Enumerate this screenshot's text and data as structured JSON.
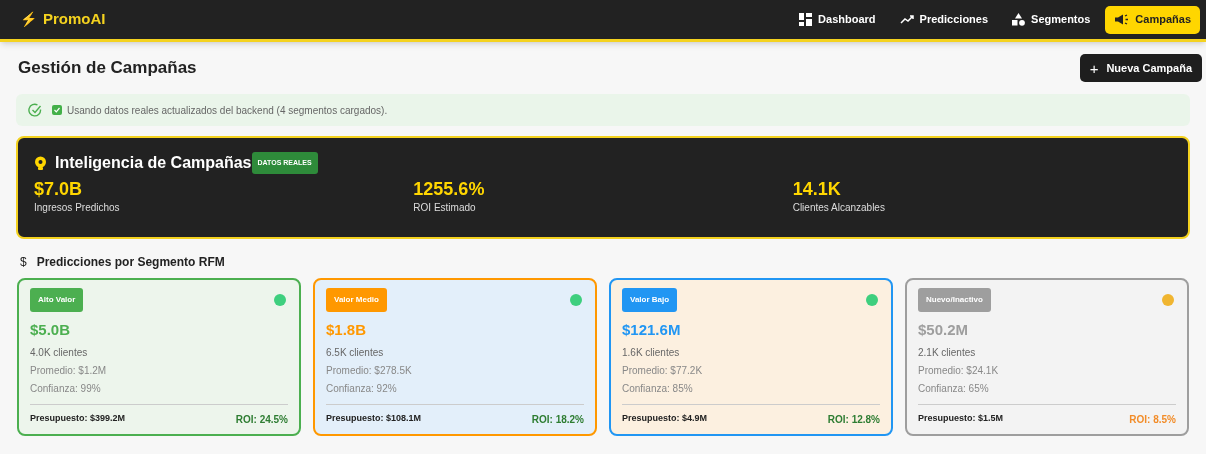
{
  "brand": {
    "icon": "⚡",
    "name": "PromoAI"
  },
  "nav": [
    {
      "label": "Dashboard",
      "kind": "grid",
      "selected": false
    },
    {
      "label": "Predicciones",
      "kind": "trend",
      "selected": false
    },
    {
      "label": "Segmentos",
      "kind": "shapes",
      "selected": false
    },
    {
      "label": "Campañas",
      "kind": "megaphone",
      "selected": true
    }
  ],
  "page_title": "Gestión de Campañas",
  "new_button": {
    "icon": "+",
    "label": "Nueva Campaña"
  },
  "alert": {
    "message": "Usando datos reales actualizados del backend (4 segmentos cargados).",
    "checked": true
  },
  "intelligence": {
    "title": "Inteligencia de Campañas",
    "badge": "DATOS REALES",
    "metrics": [
      {
        "value": "$7.0B",
        "label": "Ingresos Predichos"
      },
      {
        "value": "1255.6%",
        "label": "ROI Estimado"
      },
      {
        "value": "14.1K",
        "label": "Clientes Alcanzables"
      }
    ]
  },
  "section": {
    "icon": "$",
    "title": "Predicciones por Segmento RFM"
  },
  "segments": [
    {
      "name": "Alto Valor",
      "color": "#4caf50",
      "kind": "high",
      "warning": false,
      "revenue": "$5.0B",
      "clients": "4.0K clientes",
      "average": "Promedio: $1.2M",
      "confidence": "Confianza: 99%",
      "budget": "Presupuesto: $399.2M",
      "roi": "ROI: 24.5%",
      "roi_low": false
    },
    {
      "name": "Valor Medio",
      "color": "#ff9800",
      "kind": "medium",
      "warning": false,
      "revenue": "$1.8B",
      "clients": "6.5K clientes",
      "average": "Promedio: $278.5K",
      "confidence": "Confianza: 92%",
      "budget": "Presupuesto: $108.1M",
      "roi": "ROI: 18.2%",
      "roi_low": false
    },
    {
      "name": "Valor Bajo",
      "color": "#2196f3",
      "kind": "low",
      "warning": false,
      "revenue": "$121.6M",
      "clients": "1.6K clientes",
      "average": "Promedio: $77.2K",
      "confidence": "Confianza: 85%",
      "budget": "Presupuesto: $4.9M",
      "roi": "ROI: 12.8%",
      "roi_low": false
    },
    {
      "name": "Nuevo/Inactivo",
      "color": "#9e9e9e",
      "kind": "new",
      "warning": true,
      "revenue": "$50.2M",
      "clients": "2.1K clientes",
      "average": "Promedio: $24.1K",
      "confidence": "Confianza: 65%",
      "budget": "Presupuesto: $1.5M",
      "roi": "ROI: 8.5%",
      "roi_low": true
    }
  ]
}
